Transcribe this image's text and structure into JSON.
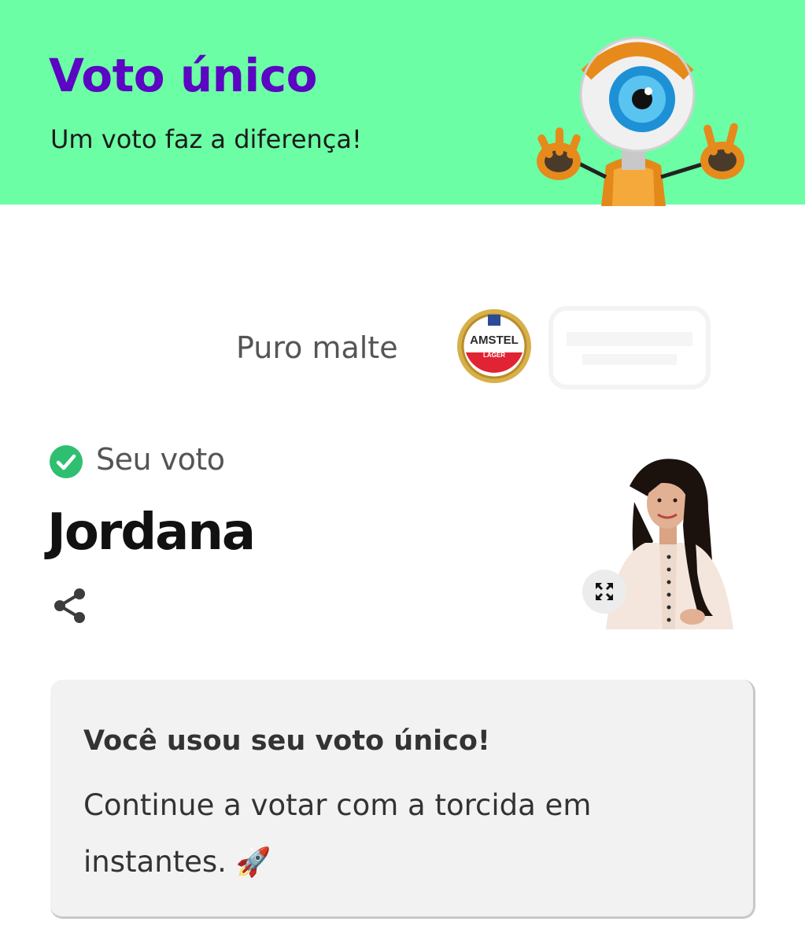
{
  "header": {
    "title": "Voto único",
    "subtitle": "Um voto faz a diferença!",
    "background_color": "#6cfea5",
    "title_color": "#5a06c2",
    "mascot_icon": "big-brother-eye-robot"
  },
  "sponsor": {
    "text": "Puro malte",
    "logo_icon": "amstel-lager-logo",
    "logo_text": "AMSTEL",
    "logo_subtext": "LAGER"
  },
  "vote": {
    "status_icon": "check-circle-icon",
    "status_label": "Seu voto",
    "candidate_name": "Jordana",
    "share_icon": "share-icon",
    "expand_icon": "expand-icon"
  },
  "message": {
    "title": "Você usou seu voto único!",
    "text": "Continue a votar com a torcida em instantes.",
    "emoji": "🚀"
  },
  "colors": {
    "check_green": "#2fbf71"
  }
}
